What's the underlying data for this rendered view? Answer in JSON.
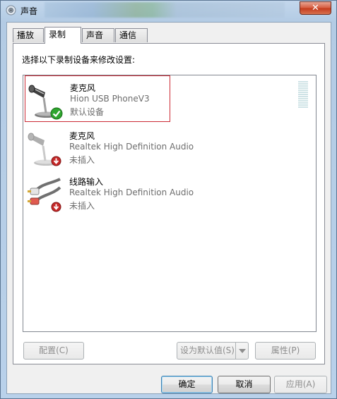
{
  "window": {
    "title": "声音",
    "close_glyph": "✕"
  },
  "tabs": [
    {
      "label": "播放",
      "active": false
    },
    {
      "label": "录制",
      "active": true
    },
    {
      "label": "声音",
      "active": false
    },
    {
      "label": "通信",
      "active": false
    }
  ],
  "recording": {
    "instruction": "选择以下录制设备来修改设置:",
    "devices": [
      {
        "name": "麦克风",
        "driver": "Hion USB PhoneV3",
        "status": "默认设备",
        "icon": "microphone-icon",
        "badge": "check-badge-icon",
        "selected": true
      },
      {
        "name": "麦克风",
        "driver": "Realtek High Definition Audio",
        "status": "未插入",
        "icon": "microphone-icon",
        "badge": "unplugged-badge-icon",
        "selected": false
      },
      {
        "name": "线路输入",
        "driver": "Realtek High Definition Audio",
        "status": "未插入",
        "icon": "line-in-icon",
        "badge": "unplugged-badge-icon",
        "selected": false
      }
    ]
  },
  "panel_buttons": {
    "configure": "配置(C)",
    "set_default": "设为默认值(S)",
    "properties": "属性(P)"
  },
  "dialog_buttons": {
    "ok": "确定",
    "cancel": "取消",
    "apply": "应用(A)"
  },
  "colors": {
    "selection_border": "#cc2b35",
    "check_green": "#2ea52e",
    "unplugged_red": "#c62828"
  }
}
